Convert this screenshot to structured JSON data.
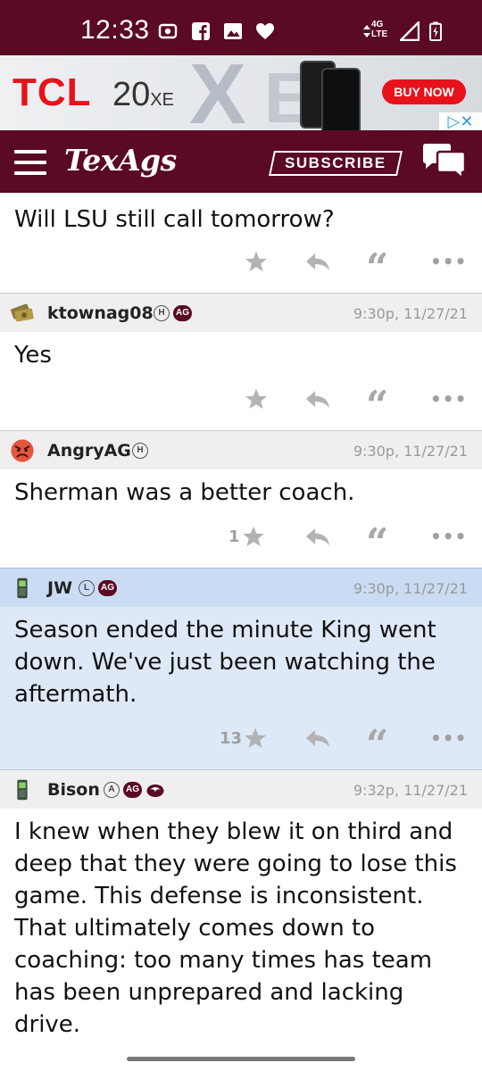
{
  "status_bar": {
    "time": "12:33",
    "network": "4G\nLTE",
    "icons": [
      "screen-record-icon",
      "facebook-icon",
      "image-icon",
      "heart-icon",
      "wifi-arrows-icon",
      "signal-icon",
      "battery-icon"
    ]
  },
  "ad": {
    "brand": "TCL",
    "model_number": "20",
    "model_suffix": "XE",
    "big_letters_1": "X",
    "big_letters_2": "E",
    "button_label": "BUY NOW",
    "adchoices": "▷✕",
    "colors": {
      "brand": "#e8121a",
      "adchoices": "#2a9fd8"
    }
  },
  "header": {
    "logo": "TexAgs",
    "subscribe_label": "SUBSCRIBE",
    "colors": {
      "maroon": "#5a0a23"
    }
  },
  "posts": [
    {
      "user": "",
      "time": "",
      "message": "Will LSU still call tomorrow?",
      "likes": "",
      "highlighted": false
    },
    {
      "user": "ktownag08",
      "badges": [
        "H",
        "AG"
      ],
      "time": "9:30p, 11/27/21",
      "message": "Yes",
      "likes": "",
      "highlighted": false
    },
    {
      "user": "AngryAG",
      "badges": [
        "H"
      ],
      "time": "9:30p, 11/27/21",
      "message": "Sherman was a better coach.",
      "likes": "1",
      "highlighted": false
    },
    {
      "user": "JW",
      "badges": [
        "L",
        "AG"
      ],
      "time": "9:30p, 11/27/21",
      "message": "Season ended the minute King went down. We've just been watching the aftermath.",
      "likes": "13",
      "highlighted": true
    },
    {
      "user": "Bison",
      "badges": [
        "A",
        "AG"
      ],
      "time": "9:32p, 11/27/21",
      "message": "I knew when they blew it on third and deep that they were going to lose this game. This defense is inconsistent. That ultimately comes down to coaching: too many times has team has been unprepared and lacking drive.",
      "likes": "",
      "highlighted": false
    }
  ],
  "actions": {
    "quote_glyph": "“",
    "more_glyph": "•••"
  }
}
